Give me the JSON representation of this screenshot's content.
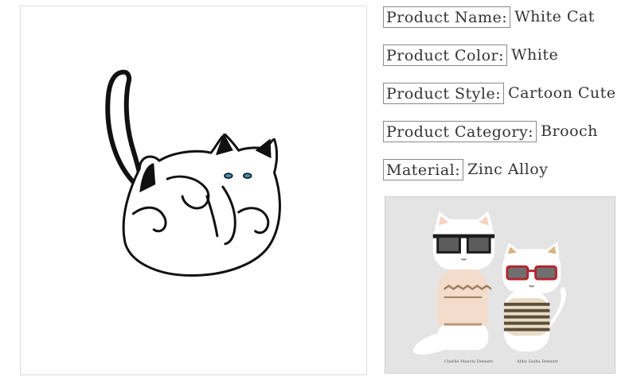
{
  "specs": [
    {
      "label": "Product Name:",
      "value": "White Cat"
    },
    {
      "label": "Product Color:",
      "value": "White"
    },
    {
      "label": "Product Style:",
      "value": "Cartoon Cute"
    },
    {
      "label": "Product Category:",
      "value": "Brooch"
    },
    {
      "label": "Material:",
      "value": "Zinc Alloy"
    }
  ],
  "secondary": {
    "captions": [
      "Charlie Manchi Dennett",
      "Abby Sasha Dennett"
    ]
  },
  "colors": {
    "outline": "#111111",
    "cat_white": "#ffffff",
    "eye_blue": "#3a8fb7",
    "panel_bg": "#e4e4e4",
    "sweater_peach": "#f3dccb",
    "sweater_stripe": "#6b5a45",
    "glasses_red": "#b3262e"
  }
}
